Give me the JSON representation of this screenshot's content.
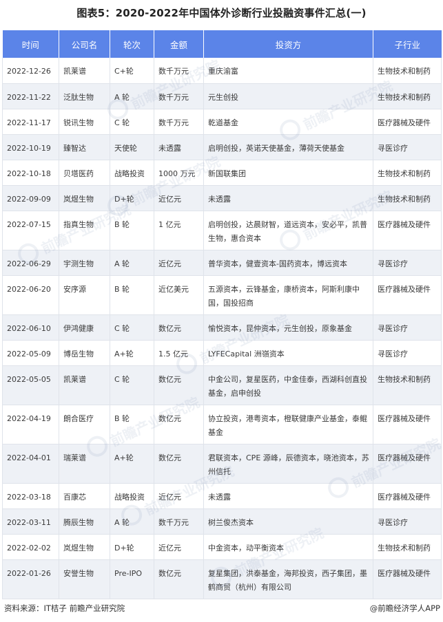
{
  "title": "图表5：2020-2022年中国体外诊断行业投融资事件汇总(一)",
  "headers": [
    "时间",
    "公司名",
    "轮次",
    "金额",
    "投资方",
    "子行业"
  ],
  "rows": [
    {
      "date": "2022-12-26",
      "company": "凯莱谱",
      "round": "C+轮",
      "amount": "数千万元",
      "investors": "重庆渝富",
      "sector": "生物技术和制药"
    },
    {
      "date": "2022-11-22",
      "company": "泛肽生物",
      "round": "A 轮",
      "amount": "数千万元",
      "investors": "元生创投",
      "sector": "生物技术和制药"
    },
    {
      "date": "2022-11-17",
      "company": "锐讯生物",
      "round": "C 轮",
      "amount": "数千万元",
      "investors": "乾道基金",
      "sector": "医疗器械及硬件"
    },
    {
      "date": "2022-10-19",
      "company": "臻智达",
      "round": "天使轮",
      "amount": "未透露",
      "investors": "启明创投，英诺天使基金，薄荷天使基金",
      "sector": "寻医诊疗"
    },
    {
      "date": "2022-10-18",
      "company": "贝塔医药",
      "round": "战略投资",
      "amount": "1000 万元",
      "investors": "新国联集团",
      "sector": "生物技术和制药"
    },
    {
      "date": "2022-09-09",
      "company": "岚煜生物",
      "round": "D+轮",
      "amount": "近亿元",
      "investors": "未透露",
      "sector": "生物技术和制药"
    },
    {
      "date": "2022-07-15",
      "company": "指真生物",
      "round": "B 轮",
      "amount": "1 亿元",
      "investors": "启明创投，达晨财智，道远资本，安必平，凯普生物，惠合资本",
      "sector": "医疗器械及硬件"
    },
    {
      "date": "2022-06-29",
      "company": "宇测生物",
      "round": "A 轮",
      "amount": "近亿元",
      "investors": "普华资本，健壹资本-国药资本，博远资本",
      "sector": "寻医诊疗"
    },
    {
      "date": "2022-06-20",
      "company": "安序源",
      "round": "B 轮",
      "amount": "近亿美元",
      "investors": "五源资本，云锋基金，康桥资本，阿斯利康中国，国投招商",
      "sector": "医疗器械及硬件"
    },
    {
      "date": "2022-06-10",
      "company": "伊鸿健康",
      "round": "C 轮",
      "amount": "数亿元",
      "investors": "愉悦资本，昆仲资本，元生创投，原象基金",
      "sector": "寻医诊疗"
    },
    {
      "date": "2022-05-09",
      "company": "博岳生物",
      "round": "A+轮",
      "amount": "1.5 亿元",
      "investors": "LYFECapital 洲嶺资本",
      "sector": "寻医诊疗"
    },
    {
      "date": "2022-05-05",
      "company": "凯莱谱",
      "round": "C 轮",
      "amount": "数亿元",
      "investors": "中金公司，复星医药，中金佳泰，西湖科创直投基金，启申创投",
      "sector": "生物技术和制药"
    },
    {
      "date": "2022-04-19",
      "company": "朗合医疗",
      "round": "B 轮",
      "amount": "数亿元",
      "investors": "协立投资，港粤资本，橙联健康产业基金，泰鲲基金",
      "sector": "医疗器械及硬件"
    },
    {
      "date": "2022-04-01",
      "company": "瑞莱谱",
      "round": "A+轮",
      "amount": "数亿元",
      "investors": "君联资本，CPE 源峰，辰德资本，晓池资本，苏州信托",
      "sector": "医疗器械及硬件"
    },
    {
      "date": "2022-03-18",
      "company": "百康芯",
      "round": "战略投资",
      "amount": "近亿元",
      "investors": "未透露",
      "sector": "医疗器械及硬件"
    },
    {
      "date": "2022-03-11",
      "company": "腾辰生物",
      "round": "A 轮",
      "amount": "数千万元",
      "investors": "树兰俊杰资本",
      "sector": "寻医诊疗"
    },
    {
      "date": "2022-02-02",
      "company": "岚煜生物",
      "round": "D+轮",
      "amount": "近亿元",
      "investors": "中金资本，动平衡资本",
      "sector": "生物技术和制药"
    },
    {
      "date": "2022-01-26",
      "company": "安誉生物",
      "round": "Pre-IPO",
      "amount": "数亿元",
      "investors": "复星集团，洪泰基金，海邦投资，西子集团，墨鹤商贸（杭州）有限公司",
      "sector": "医疗器械及硬件"
    }
  ],
  "watermark": "前瞻产业研究院",
  "footer": {
    "source": "资料来源：IT桔子 前瞻产业研究院",
    "brand": "@前瞻经济学人APP"
  },
  "colors": {
    "header_bg": "#5b84e8",
    "alt_row_bg": "#eef1f6"
  }
}
